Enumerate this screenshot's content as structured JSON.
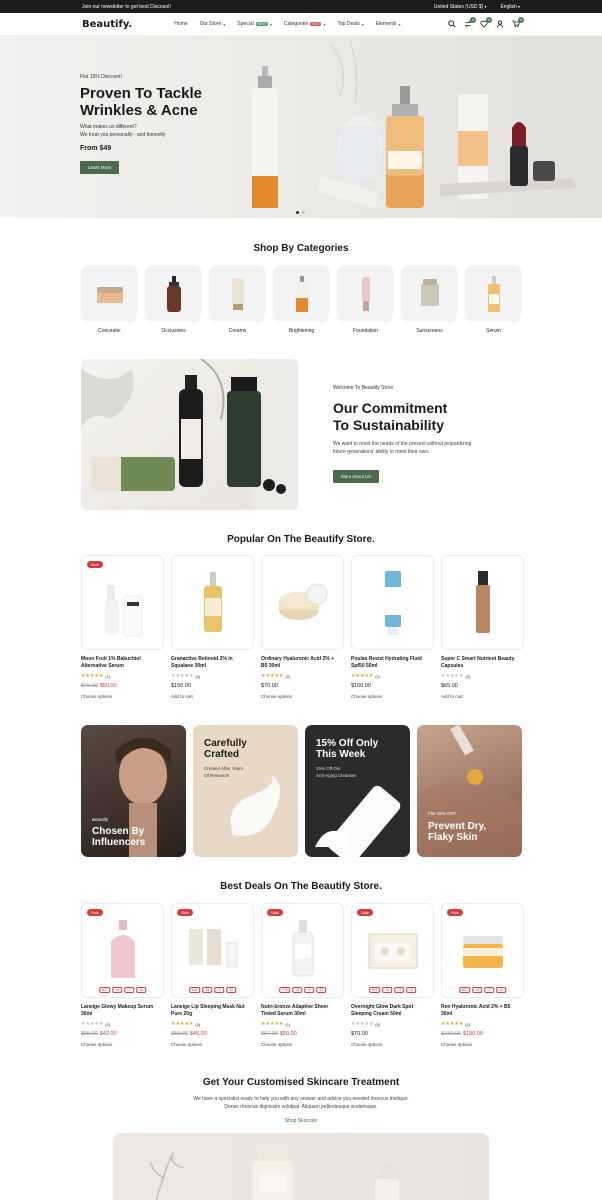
{
  "topbar": {
    "announcement": "Join our newsletter to get best Discount!",
    "country": "United States (USD $)",
    "language": "English"
  },
  "nav": {
    "logo": "Beautify.",
    "menu": [
      {
        "label": "Home",
        "caret": false,
        "tag": ""
      },
      {
        "label": "Our Store",
        "caret": true,
        "tag": ""
      },
      {
        "label": "Special",
        "caret": true,
        "tag": "NEW"
      },
      {
        "label": "Categories",
        "caret": true,
        "tag": "HOT"
      },
      {
        "label": "Top Deals",
        "caret": true,
        "tag": ""
      },
      {
        "label": "Elements",
        "caret": true,
        "tag": ""
      }
    ],
    "badges": {
      "compare": "0",
      "wishlist": "0",
      "cart": "0"
    },
    "colors": {
      "new_tag": "#4a9a6a",
      "hot_tag": "#e0574f",
      "badge": "#4a7a4f"
    }
  },
  "hero": {
    "eyebrow": "Flat 15% Discount!",
    "title_line1": "Proven To Tackle",
    "title_line2": "Wrinkles & Acne",
    "sub_line1": "What makes us different?",
    "sub_line2": "We treat you personally - and honestly",
    "price": "From $49",
    "button": "Learn More"
  },
  "categories": {
    "heading": "Shop By Categories",
    "items": [
      "Concealer",
      "Occlusives",
      "Creams",
      "Brightening",
      "Foundation",
      "Sunscreens",
      "Serum"
    ]
  },
  "sustain": {
    "eyebrow": "Welcome To Beautify Store",
    "title_line1": "Our Commitment",
    "title_line2": "To Sustainability",
    "text_line1": "We want to meet the needs of the present without jeopardizing",
    "text_line2": "future generations' ability to meet their own.",
    "button": "More About Us"
  },
  "popular": {
    "heading": "Popular On The Beautify Store.",
    "products": [
      {
        "name_line1": "Moon Fruit 1% Bakuchiol",
        "name_line2": "Alternative Serum",
        "reviews": "(1)",
        "old_price": "$75.00",
        "price": "$50.00",
        "action": "Choose options",
        "sale": "Sale",
        "stars": "★★★★★"
      },
      {
        "name_line1": "Granactive Retinoid 2% in",
        "name_line2": "Squalane 30ml",
        "reviews": "(0)",
        "old_price": "",
        "price": "$150.00",
        "action": "Add to cart",
        "sale": "",
        "stars": "★★★★★"
      },
      {
        "name_line1": "Ordinary Hyaluronic Acid 2% +",
        "name_line2": "B5 30ml",
        "reviews": "(2)",
        "old_price": "",
        "price": "$70.00",
        "action": "Choose options",
        "sale": "",
        "stars": "★★★★★"
      },
      {
        "name_line1": "Poulas Resist Hydrating Fluid",
        "name_line2": "Spf50 50ml",
        "reviews": "(1)",
        "old_price": "",
        "price": "$160.00",
        "action": "Choose options",
        "sale": "",
        "stars": "★★★★★"
      },
      {
        "name_line1": "Super C Smart Nutrient Beauty",
        "name_line2": "Capsules",
        "reviews": "(0)",
        "old_price": "",
        "price": "$65.00",
        "action": "Add to cart",
        "sale": "",
        "stars": "★★★★★"
      }
    ]
  },
  "banners": [
    {
      "pre": "Beautify",
      "title_line1": "Chosen By",
      "title_line2": "Influencers",
      "sub_line1": "",
      "sub_line2": ""
    },
    {
      "pre": "",
      "title_line1": "Carefully",
      "title_line2": "Crafted",
      "sub_line1": "Created After Years",
      "sub_line2": "Of Research"
    },
    {
      "pre": "",
      "title_line1": "15% Off Only",
      "title_line2": "This Week",
      "sub_line1": "15% Off Our",
      "sub_line2": "Anti-Aging Cleanser"
    },
    {
      "pre": "Flat 15% OFF",
      "title_line1": "Prevent Dry,",
      "title_line2": "Flaky Skin",
      "sub_line1": "",
      "sub_line2": ""
    }
  ],
  "deals": {
    "heading": "Best Deals On The Beautify Store.",
    "products": [
      {
        "name_line1": "Laneige Glowy Makeup Serum",
        "name_line2": "30ml",
        "reviews": "(0)",
        "old_price": "$55.00",
        "price": "$42.00",
        "action": "Choose options",
        "sale": "Sale",
        "timer": [
          "607",
          "14",
          "07",
          "32"
        ],
        "stars": "★★★★★"
      },
      {
        "name_line1": "Laneige Lip Sleeping Mask Nut",
        "name_line2": "Pure 20g",
        "reviews": "(3)",
        "old_price": "$50.00",
        "price": "$45.00",
        "action": "Choose options",
        "sale": "Sale",
        "timer": [
          "626",
          "14",
          "07",
          "32"
        ],
        "stars": "★★★★★"
      },
      {
        "name_line1": "Nutri-bronze Adaptive Sheer",
        "name_line2": "Tinted Serum 30ml",
        "reviews": "(1)",
        "old_price": "$57.00",
        "price": "$50.00",
        "action": "Choose options",
        "sale": "Sale",
        "timer": [
          "775",
          "14",
          "07",
          "32"
        ],
        "stars": "★★★★★"
      },
      {
        "name_line1": "Overnight Glow Dark Spot",
        "name_line2": "Sleeping Cream 50ml",
        "reviews": "(0)",
        "old_price": "",
        "price": "$70.00",
        "action": "Choose options",
        "sale": "Sale",
        "timer": [
          "637",
          "14",
          "07",
          "32"
        ],
        "stars": "★★★★★"
      },
      {
        "name_line1": "Ren Hyaluronic Acid 2% + B5",
        "name_line2": "30ml",
        "reviews": "(2)",
        "old_price": "$180.00",
        "price": "$150.00",
        "action": "Choose options",
        "sale": "Sale",
        "timer": [
          "622",
          "14",
          "07",
          "32"
        ],
        "stars": "★★★★★"
      }
    ]
  },
  "skincare": {
    "heading": "Get Your Customised Skincare Treatment",
    "text_line1": "We have a specialist ready to help you with any answer and advice you needed rhoncus tristique.",
    "text_line2": "Donec rhoncus dignissim volutpat. Aliquam pellentesque scelerisque.",
    "link": "Shop Skincare"
  }
}
